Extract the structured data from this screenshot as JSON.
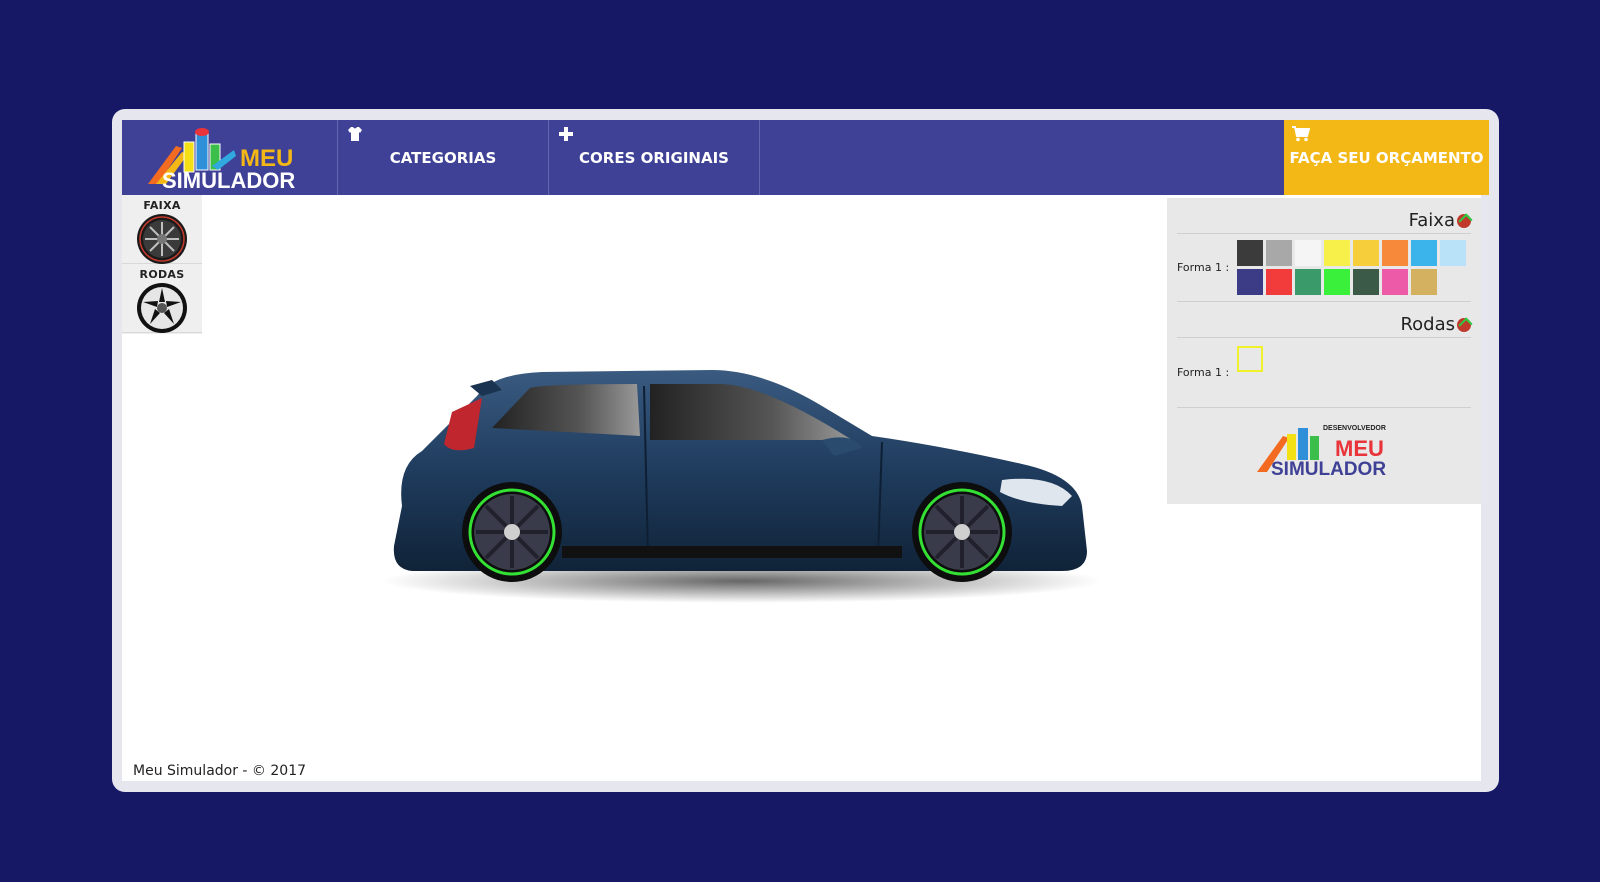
{
  "nav": {
    "logo_line1": "MEU",
    "logo_line2": "SIMULADOR",
    "tabs": [
      {
        "label": "CATEGORIAS",
        "icon": "shirt-icon"
      },
      {
        "label": "CORES ORIGINAIS",
        "icon": "plus-icon"
      }
    ],
    "cta": {
      "label": "FAÇA SEU ORÇAMENTO",
      "icon": "cart-icon"
    }
  },
  "categories": [
    {
      "label": "FAIXA"
    },
    {
      "label": "RODAS"
    }
  ],
  "panel": {
    "sections": [
      {
        "title": "Faixa",
        "form_label": "Forma 1 :",
        "swatches": [
          "#3b3b3b",
          "#a8a8a8",
          "#f5f5f5",
          "#f7ef4a",
          "#f6cd3a",
          "#f7893b",
          "#3bb4ec",
          "#b9e1f7",
          "#3b3b86",
          "#f23b3b",
          "#3b9a6a",
          "#3bf03b",
          "#3b5a47",
          "#ec5aa8",
          "#d4b061"
        ]
      },
      {
        "title": "Rodas",
        "form_label": "Forma 1 :",
        "selected_color": "#f1f12a"
      }
    ],
    "developer_label": "DESENVOLVEDOR",
    "developer_logo_line1": "MEU",
    "developer_logo_line2": "SIMULADOR"
  },
  "footer": "Meu Simulador - © 2017",
  "colors": {
    "background": "#161865",
    "nav": "#3f4196",
    "cta": "#f3b716",
    "car_body": "#1e3a5c",
    "rim_stripe": "#33e033"
  }
}
